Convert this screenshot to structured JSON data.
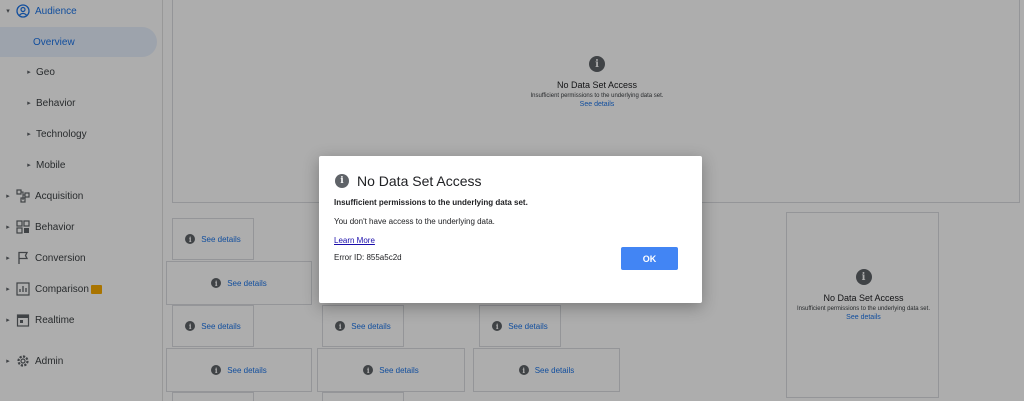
{
  "sidebar": {
    "audience": {
      "label": "Audience",
      "icon": "person-circle-icon"
    },
    "overview": {
      "label": "Overview"
    },
    "sub_items": [
      "Geo",
      "Behavior",
      "Technology",
      "Mobile"
    ],
    "sections": [
      {
        "label": "Acquisition",
        "icon": "acquisition-icon"
      },
      {
        "label": "Behavior",
        "icon": "behavior-icon"
      },
      {
        "label": "Conversion",
        "icon": "flag-icon"
      },
      {
        "label": "Comparison",
        "icon": "comparison-icon",
        "badge": "new"
      },
      {
        "label": "Realtime",
        "icon": "calendar-icon"
      },
      {
        "label": "Admin",
        "icon": "gear-icon"
      }
    ]
  },
  "main": {
    "big_panel": {
      "title": "No Data Set Access",
      "subtitle": "Insufficient permissions to the underlying data set.",
      "link": "See details"
    },
    "right_panel": {
      "title": "No Data Set Access",
      "subtitle": "Insufficient permissions to the underlying data set.",
      "link": "See details"
    },
    "tile_link": "See details"
  },
  "dialog": {
    "title": "No Data Set Access",
    "bold_text": "Insufficient permissions to the underlying data set.",
    "text": "You don't have access to the underlying data.",
    "learn_more": "Learn More",
    "error_id": "Error ID: 855a5c2d",
    "ok_label": "OK"
  },
  "colors": {
    "accent": "#1a73e8",
    "ok_button": "#4285f4"
  }
}
